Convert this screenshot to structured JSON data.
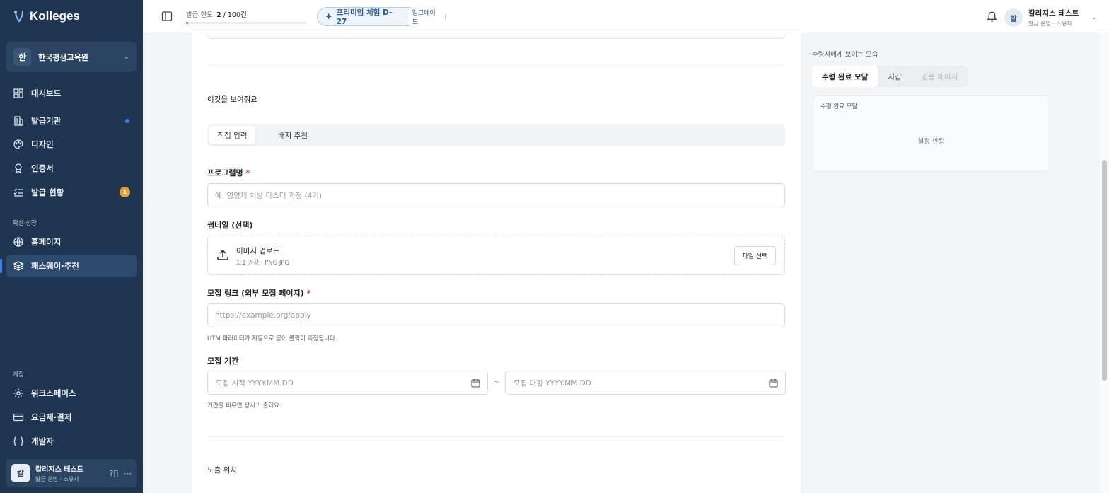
{
  "sidebar": {
    "logo_text": "Kolleges",
    "org": {
      "badge": "한",
      "name": "한국평생교육원"
    },
    "nav": [
      {
        "label": "대시보드",
        "icon": "dashboard-icon"
      },
      {
        "label": "발급기관",
        "icon": "building-icon",
        "indicator": "dot"
      },
      {
        "label": "디자인",
        "icon": "palette-icon"
      },
      {
        "label": "인증서",
        "icon": "award-icon"
      },
      {
        "label": "발급 현황",
        "icon": "list-check-icon",
        "count": "1"
      }
    ],
    "growth_label": "확산·성장",
    "growth_nav": [
      {
        "label": "홈페이지",
        "icon": "globe-icon"
      },
      {
        "label": "패스웨이·추천",
        "icon": "layers-icon",
        "active": true
      }
    ],
    "account_label": "계정",
    "account_nav": [
      {
        "label": "워크스페이스",
        "icon": "gear-icon"
      },
      {
        "label": "요금제·결제",
        "icon": "credit-card-icon"
      },
      {
        "label": "개발자",
        "icon": "braces-icon"
      }
    ],
    "user": {
      "avatar": "칼",
      "name": "칼리지스 테스트",
      "role": "발급 운영 · 소유자"
    }
  },
  "topbar": {
    "quota_label": "발급 한도",
    "quota_used": "2",
    "quota_total": "/ 100건",
    "quota_fraction": 0.02,
    "premium_label": "프리미엄 체험 D-27",
    "upgrade_label": "업그레이드",
    "user": {
      "avatar": "칼",
      "name": "칼리지스 테스트",
      "role": "발급 운영 · 소유자"
    }
  },
  "form": {
    "show_label": "이것을 보여줘요",
    "mode_tabs": [
      "직접 입력",
      "배지 추천"
    ],
    "program_label": "프로그램명",
    "required_mark": "*",
    "program_placeholder": "예: 영양제 처방 마스터 과정 (4기)",
    "thumb_label": "썸네일 (선택)",
    "upload_title": "이미지 업로드",
    "upload_sub": "1:1 권장 · PNG·JPG",
    "file_button": "파일 선택",
    "link_label": "모집 링크 (외부 모집 페이지)",
    "link_placeholder": "https://example.org/apply",
    "link_help": "UTM 파라미터가 자동으로 붙어 클릭이 측정됩니다.",
    "period_label": "모집 기간",
    "start_placeholder": "모집 시작 YYYY.MM.DD",
    "tilde": "~",
    "end_placeholder": "모집 마감 YYYY.MM.DD",
    "period_help": "기간을 비우면 상시 노출돼요.",
    "position_label": "노출 위치"
  },
  "preview": {
    "title": "수령자에게 보이는 모습",
    "tabs": [
      "수령 완료 모달",
      "지갑",
      "검증 페이지"
    ],
    "card_header": "수령 완료 모달",
    "card_empty": "설정 안됨"
  },
  "colors": {
    "sidebar": "#1f3551",
    "accent": "#2563eb",
    "badge": "#e0a030",
    "required": "#e53e3e"
  }
}
